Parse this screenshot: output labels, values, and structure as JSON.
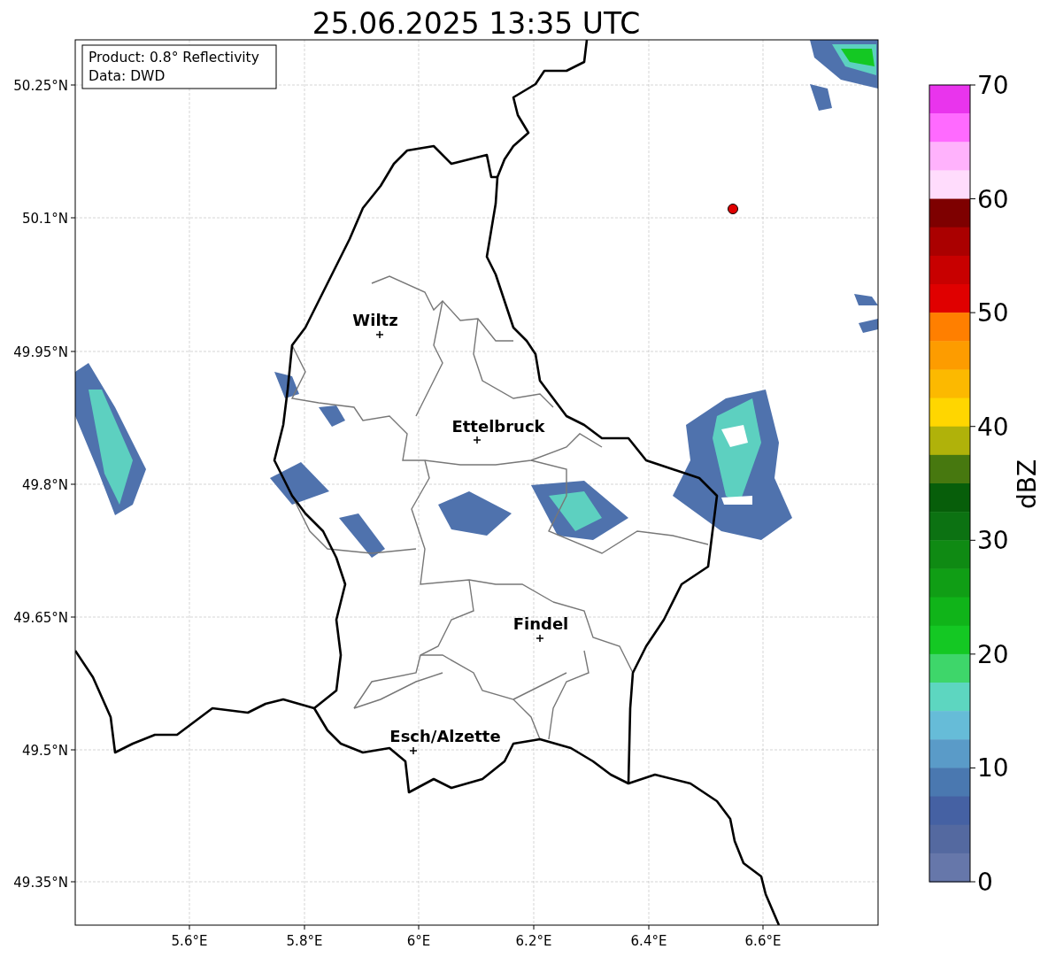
{
  "title": "25.06.2025 13:35 UTC",
  "info_box": [
    "Product: 0.8° Reflectivity",
    "Data: DWD"
  ],
  "yticks": [
    "50.25°N",
    "50.1°N",
    "49.95°N",
    "49.8°N",
    "49.65°N",
    "49.5°N",
    "49.35°N"
  ],
  "xticks": [
    "5.6°E",
    "5.8°E",
    "6°E",
    "6.2°E",
    "6.4°E",
    "6.6°E"
  ],
  "cities": [
    {
      "name": "Wiltz"
    },
    {
      "name": "Ettelbruck"
    },
    {
      "name": "Findel"
    },
    {
      "name": "Esch/Alzette"
    }
  ],
  "colorbar": {
    "label": "dBZ",
    "ticks": [
      "70",
      "60",
      "50",
      "40",
      "30",
      "20",
      "10",
      "0"
    ],
    "steps": [
      {
        "color": "#e934ed"
      },
      {
        "color": "#ff6aff"
      },
      {
        "color": "#ffb2fc"
      },
      {
        "color": "#ffdcfc"
      },
      {
        "color": "#7e0000"
      },
      {
        "color": "#aa0000"
      },
      {
        "color": "#c80000"
      },
      {
        "color": "#e00000"
      },
      {
        "color": "#ff7f00"
      },
      {
        "color": "#fd9c00"
      },
      {
        "color": "#fcb900"
      },
      {
        "color": "#ffd600"
      },
      {
        "color": "#b0b20a"
      },
      {
        "color": "#47780f"
      },
      {
        "color": "#075e0a"
      },
      {
        "color": "#0c7212"
      },
      {
        "color": "#0f8a13"
      },
      {
        "color": "#109e15"
      },
      {
        "color": "#10b419"
      },
      {
        "color": "#14c823"
      },
      {
        "color": "#3ed66a"
      },
      {
        "color": "#5dd6c0"
      },
      {
        "color": "#66bcd8"
      },
      {
        "color": "#5a9bc8"
      },
      {
        "color": "#4a78b0"
      },
      {
        "color": "#4561a3"
      },
      {
        "color": "#5469a0"
      },
      {
        "color": "#6677aa"
      }
    ]
  }
}
